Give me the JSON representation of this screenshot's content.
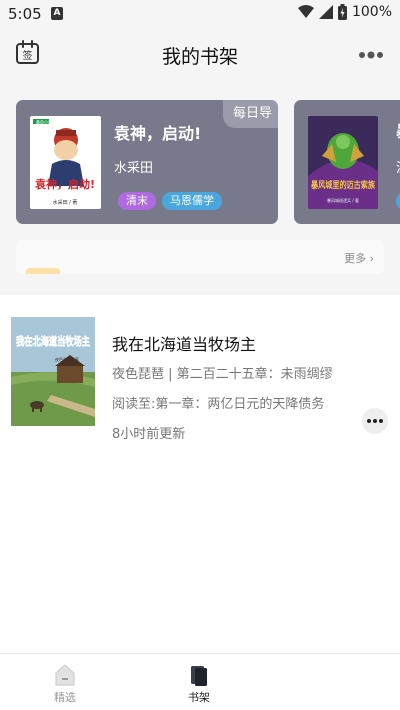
{
  "status_bar": {
    "time": "5:05",
    "notification_icon_label": "A",
    "battery": "100%"
  },
  "header": {
    "title": "我的书架",
    "signin_icon_label": "签"
  },
  "featured": [
    {
      "title": "袁神，启动!",
      "author": "水采田",
      "tags": [
        "清末",
        "马恩儒学"
      ],
      "badge": "每日导",
      "cover_title": "袁神，启动!",
      "cover_author": "水采田 / 著",
      "cover_publisher": "番茄小说"
    },
    {
      "title_fragment": "暴",
      "sub_fragment": "泥",
      "cover_title": "暴风城里的迈古索族",
      "cover_author": "暴风城巡逻兵 / 著"
    }
  ],
  "notice": {
    "more_label": "更多"
  },
  "shelf": {
    "books": [
      {
        "title": "我在北海道当牧场主",
        "author": "夜色琵琶",
        "latest_chapter": "第二百二十五章：未雨绸缪",
        "progress": "阅读至:第一章：两亿日元的天降债务",
        "updated": "8小时前更新",
        "cover_title": "我在北海道当牧场主",
        "cover_author": "夜色琵琶 / 著"
      }
    ]
  },
  "bottom_nav": {
    "items": [
      {
        "label": "精选",
        "active": false
      },
      {
        "label": "书架",
        "active": true
      }
    ]
  },
  "colors": {
    "card_bg": "#787a8c",
    "tag_purple": "#b06ae0",
    "tag_blue": "#49a7dd",
    "page_bg": "#f5f5f6"
  }
}
